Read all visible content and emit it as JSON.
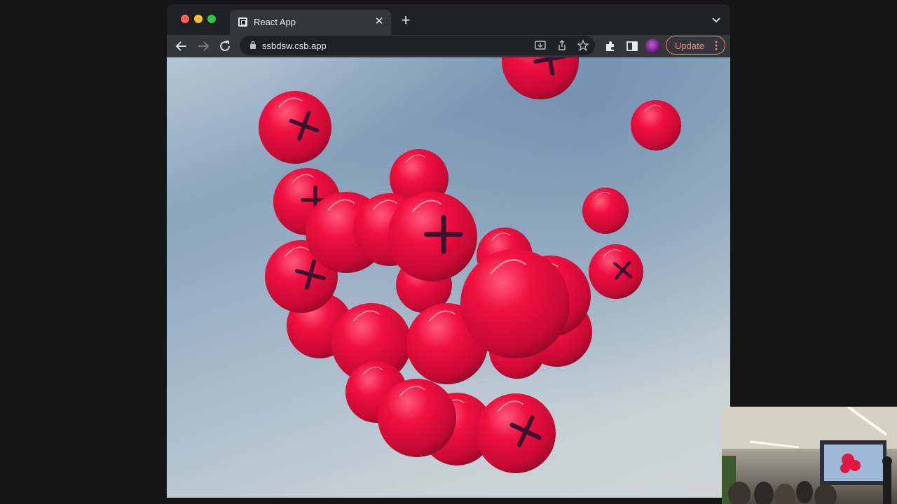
{
  "browser": {
    "tab": {
      "title": "React App"
    },
    "toolbar": {
      "url": "ssbdsw.csb.app",
      "update_label": "Update"
    }
  },
  "colors": {
    "ball": "#f0103f",
    "chrome_dark": "#202124",
    "chrome_light": "#35363a",
    "accent": "#f28b82"
  },
  "icons": [
    "back-icon",
    "forward-icon",
    "reload-icon",
    "lock-icon",
    "install-icon",
    "share-icon",
    "bookmark-star-icon",
    "extensions-icon",
    "side-panel-icon",
    "profile-avatar",
    "more-vert-icon",
    "tab-search-icon"
  ]
}
